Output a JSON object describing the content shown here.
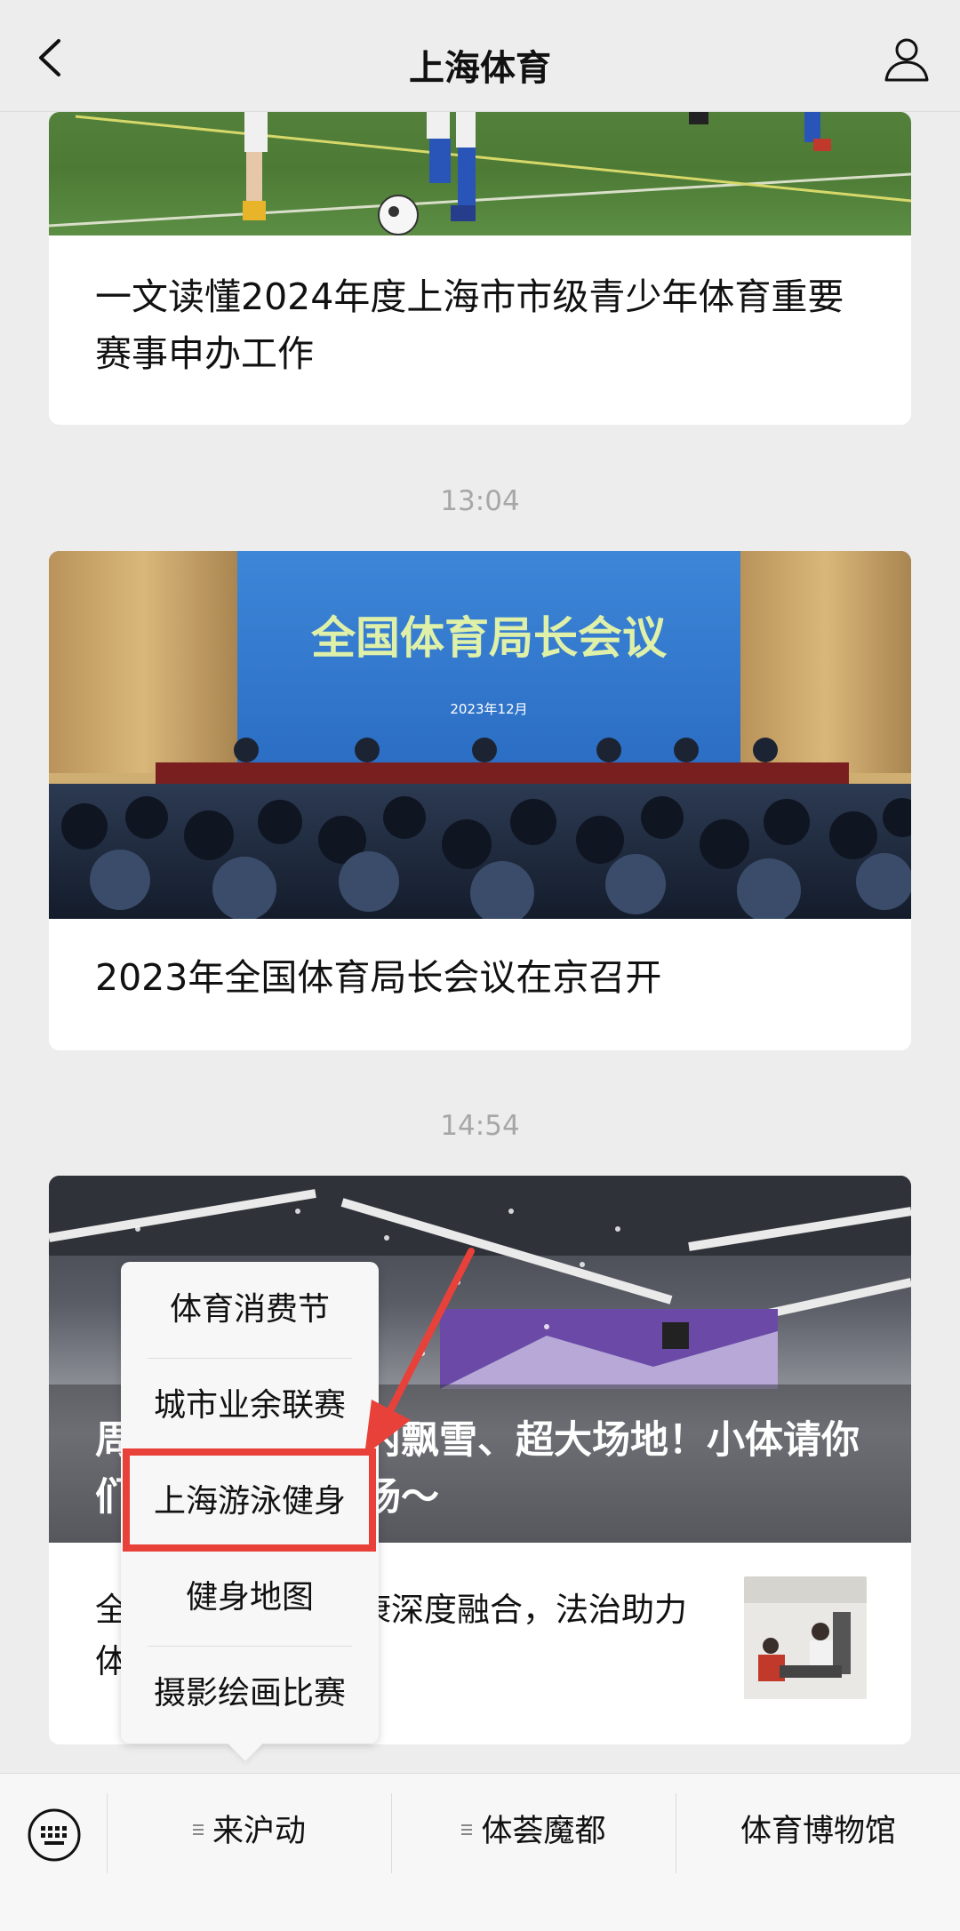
{
  "header": {
    "title": "上海体育",
    "back_icon": "chevron-left-icon",
    "profile_icon": "person-icon"
  },
  "feed": {
    "items": [
      {
        "caption": "一文读懂2024年度上海市市级青少年体育重要赛事申办工作"
      },
      {
        "time": "13:04",
        "image_banner": "全国体育局长会议",
        "image_date": "2023年12月",
        "caption": "2023年全国体育局长会议在京召开"
      },
      {
        "time": "14:54",
        "overlay_title": "周末去哪儿？室内飘雪、超大场地！小体请你们来探浪漫滑雪场～",
        "subtitle": "全民健身与全民健康深度融合，法治助力体育高质量发展"
      }
    ]
  },
  "popup_menu": {
    "items": [
      "体育消费节",
      "城市业余联赛",
      "上海游泳健身",
      "健身地图",
      "摄影绘画比赛"
    ],
    "highlighted": "上海游泳健身",
    "highlight_color": "#e8413a"
  },
  "bottom_menu": {
    "keyboard_icon": "keyboard-icon",
    "items": [
      "来沪动",
      "体荟魔都",
      "体育博物馆"
    ]
  }
}
